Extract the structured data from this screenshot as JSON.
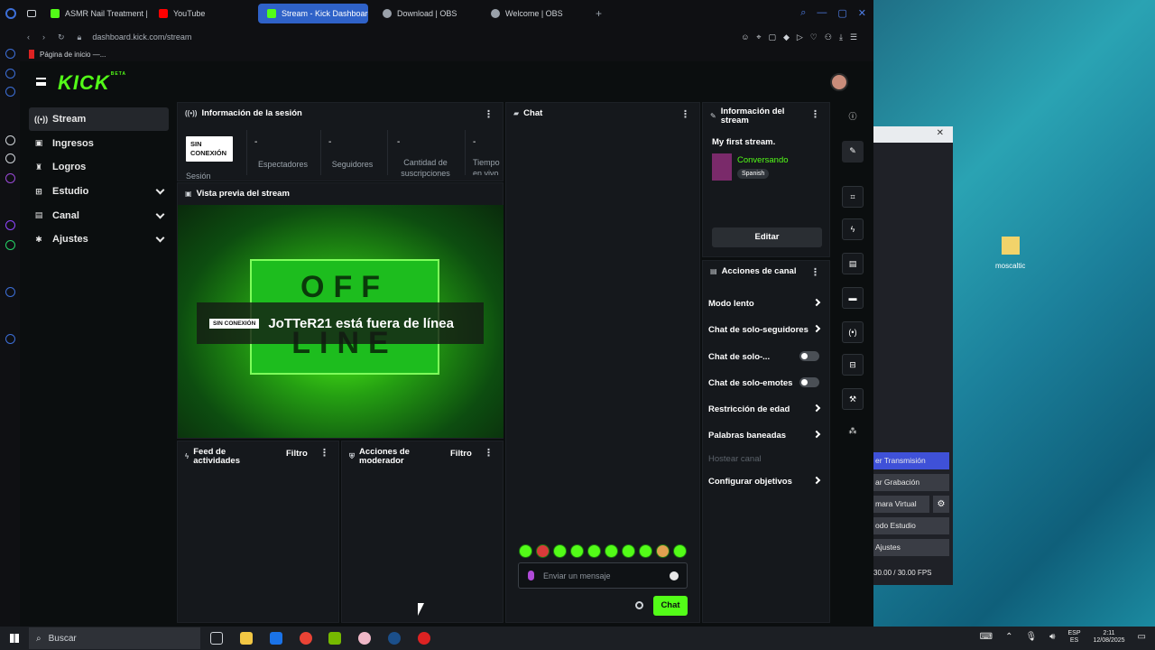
{
  "browser": {
    "tabs": [
      {
        "label": "ASMR Nail Treatment | N"
      },
      {
        "label": "YouTube"
      },
      {
        "label": "Stream - Kick Dashboard"
      },
      {
        "label": "Download | OBS"
      },
      {
        "label": "Welcome | OBS"
      }
    ],
    "url": "dashboard.kick.com/stream",
    "bookmark": "Página de inicio —..."
  },
  "kick": {
    "logo": "KICK",
    "logo_badge": "BETA",
    "nav": [
      {
        "label": "Stream",
        "icon": "broadcast-icon"
      },
      {
        "label": "Ingresos",
        "icon": "wallet-icon"
      },
      {
        "label": "Logros",
        "icon": "trophy-icon"
      },
      {
        "label": "Estudio",
        "icon": "grid-icon"
      },
      {
        "label": "Canal",
        "icon": "channel-icon"
      },
      {
        "label": "Ajustes",
        "icon": "gear-icon"
      }
    ],
    "session": {
      "title": "Información de la sesión",
      "badge": "SIN CONEXIÓN",
      "badge_label": "Sesión",
      "stats": [
        {
          "value": "-",
          "label": "Espectadores"
        },
        {
          "value": "-",
          "label": "Seguidores"
        },
        {
          "value": "-",
          "label": "Cantidad de suscripciones"
        },
        {
          "value": "-",
          "label": "Tiempo en vivo"
        }
      ]
    },
    "preview": {
      "title": "Vista previa del stream",
      "offline_big_1": "OFF",
      "offline_big_2": "LINE",
      "banner_tag": "SIN CONEXIÓN",
      "banner_msg": "JoTTeR21 está fuera de línea"
    },
    "feed": {
      "title": "Feed de actividades",
      "filter": "Filtro"
    },
    "mod": {
      "title": "Acciones de moderador",
      "filter": "Filtro"
    },
    "chat": {
      "title": "Chat",
      "placeholder": "Enviar un mensaje",
      "send": "Chat"
    },
    "stream_info": {
      "title": "Información del stream",
      "stream_title": "My first stream.",
      "category": "Conversando",
      "language": "Spanish",
      "edit": "Editar"
    },
    "channel_actions": {
      "title": "Acciones de canal",
      "items": [
        {
          "label": "Modo lento",
          "control": "arrow"
        },
        {
          "label": "Chat de solo-seguidores",
          "control": "arrow"
        },
        {
          "label": "Chat de solo-...",
          "control": "toggle"
        },
        {
          "label": "Chat de solo-emotes",
          "control": "toggle"
        },
        {
          "label": "Restricción de edad",
          "control": "arrow"
        },
        {
          "label": "Palabras baneadas",
          "control": "arrow"
        },
        {
          "label": "Hostear canal",
          "control": "disabled"
        },
        {
          "label": "Configurar objetivos",
          "control": "arrow"
        }
      ]
    }
  },
  "obs": {
    "buttons": [
      "er Transmisión",
      "ar Grabación",
      "mara Virtual",
      "odo Estudio",
      "Ajustes"
    ],
    "status": "30.00 / 30.00 FPS"
  },
  "desktop": {
    "folder_label": "moscaltic"
  },
  "taskbar": {
    "search": "Buscar",
    "lang": "ESP",
    "lang2": "ES",
    "time": "2:11",
    "date": "12/08/2025"
  },
  "colors": {
    "accent": "#53fc18",
    "tab_active": "#2f62c8",
    "obs_highlight": "#3f51d8"
  }
}
